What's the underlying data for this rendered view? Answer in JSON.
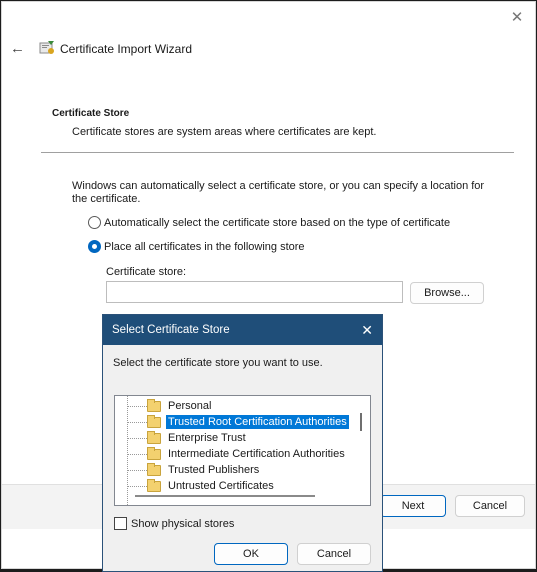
{
  "wizard": {
    "title": "Certificate Import Wizard",
    "section_title": "Certificate Store",
    "section_desc": "Certificate stores are system areas where certificates are kept.",
    "intro": "Windows can automatically select a certificate store, or you can specify a location for the certificate.",
    "radio_auto": "Automatically select the certificate store based on the type of certificate",
    "radio_manual": "Place all certificates in the following store",
    "selected_option": "manual",
    "store_label": "Certificate store:",
    "store_value": "",
    "browse_label": "Browse...",
    "next_label": "Next",
    "cancel_label": "Cancel",
    "icons": {
      "back": "back-arrow-icon",
      "close": "close-icon",
      "wizard": "certificate-icon"
    }
  },
  "dialog": {
    "title": "Select Certificate Store",
    "prompt": "Select the certificate store you want to use.",
    "stores": [
      {
        "label": "Personal",
        "selected": false
      },
      {
        "label": "Trusted Root Certification Authorities",
        "selected": true
      },
      {
        "label": "Enterprise Trust",
        "selected": false
      },
      {
        "label": "Intermediate Certification Authorities",
        "selected": false
      },
      {
        "label": "Trusted Publishers",
        "selected": false
      },
      {
        "label": "Untrusted Certificates",
        "selected": false
      }
    ],
    "show_physical_label": "Show physical stores",
    "show_physical_checked": false,
    "ok_label": "OK",
    "cancel_label": "Cancel"
  },
  "colors": {
    "accent": "#0067c0",
    "dialog_titlebar": "#1f4e79",
    "selection": "#0078d7"
  }
}
